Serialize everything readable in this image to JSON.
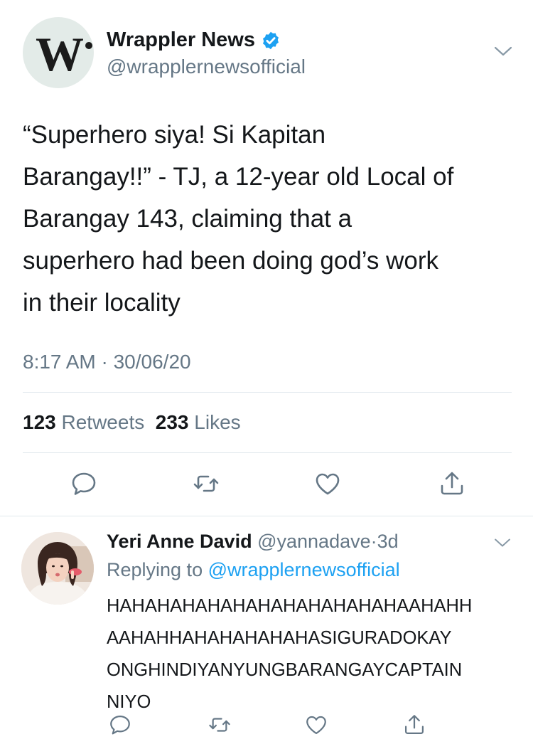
{
  "main_tweet": {
    "author_name": "Wrappler News",
    "author_handle": "@wrapplernewsofficial",
    "avatar_logo": "W",
    "verified_icon": "verified-badge-icon",
    "text_lines": [
      "“Superhero siya! Si Kapitan",
      "Barangay!!” - TJ, a 12-year old Local of",
      "Barangay 143, claiming that a",
      "superhero had been doing god’s work",
      "in their locality"
    ],
    "timestamp": "8:17 AM · 30/06/20",
    "retweets_count": "123",
    "retweets_label": "Retweets",
    "likes_count": "233",
    "likes_label": "Likes",
    "actions": [
      "reply-icon",
      "retweet-icon",
      "like-icon",
      "share-icon"
    ]
  },
  "reply": {
    "author_name": "Yeri Anne David",
    "author_handle": "@yannadave",
    "time_ago": "3d",
    "separator": "·",
    "replying_prefix": "Replying to",
    "replying_to": "@wrapplernewsofficial",
    "text_lines": [
      "HAHAHAHAHAHAHAHAHAHAHAHAAHAHH",
      "AAHAHHAHAHAHAHAHASIGURADOKAY",
      "ONGHINDIYANYUNGBARANGAYCAPTAIN",
      "NIYO"
    ],
    "actions": [
      "reply-icon",
      "retweet-icon",
      "like-icon",
      "share-icon"
    ]
  },
  "colors": {
    "text_primary": "#14171a",
    "text_secondary": "#657786",
    "accent": "#1da1f2",
    "divider": "#e1e8ed"
  }
}
